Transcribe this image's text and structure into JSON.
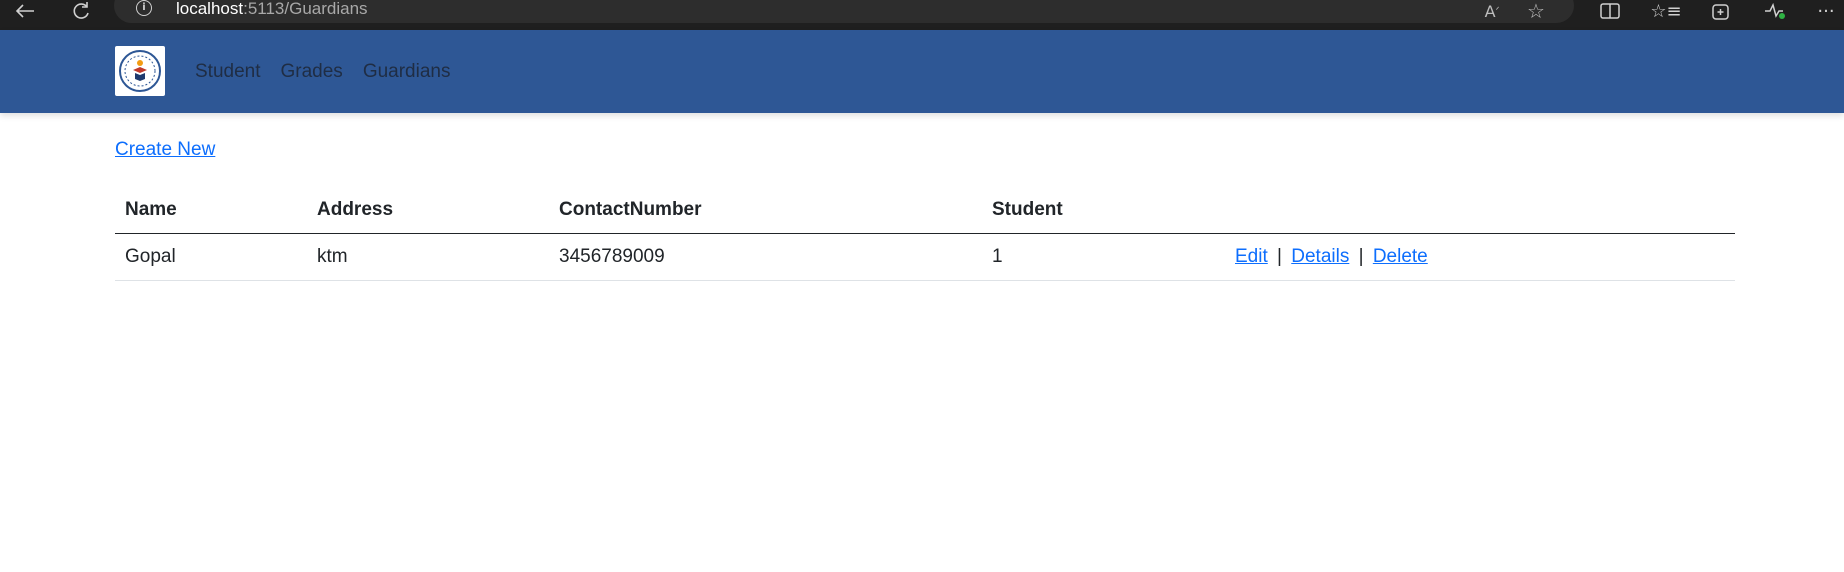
{
  "browser": {
    "address_host": "localhost",
    "address_path": ":5113/Guardians",
    "icons": [
      "back-icon",
      "refresh-icon",
      "info-icon",
      "read-aloud-icon",
      "favorite-star-icon",
      "split-screen-icon",
      "favorites-icon",
      "collections-icon",
      "performance-icon",
      "more-icon"
    ]
  },
  "navbar": {
    "logo_icon": "school-logo",
    "links": [
      "Student",
      "Grades",
      "Guardians"
    ]
  },
  "main": {
    "create_label": "Create New",
    "table": {
      "headers": [
        "Name",
        "Address",
        "ContactNumber",
        "Student",
        ""
      ],
      "rows": [
        {
          "name": "Gopal",
          "address": "ktm",
          "contact": "3456789009",
          "student": "1",
          "actions": {
            "edit": "Edit",
            "details": "Details",
            "delete": "Delete",
            "separator": "|"
          }
        }
      ]
    }
  },
  "colors": {
    "navbar": "#2e5795",
    "link": "#0d6efd",
    "chrome": "#1f1f1f"
  }
}
